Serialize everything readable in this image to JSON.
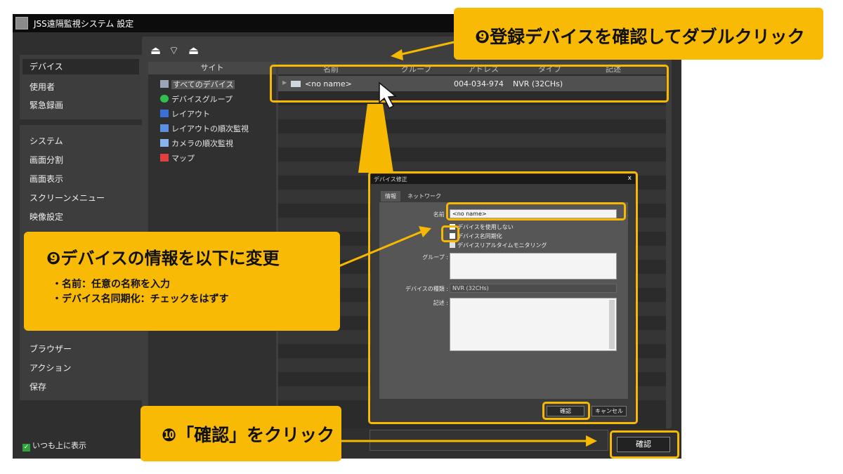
{
  "window": {
    "title": "JSS遠隔監視システム 設定"
  },
  "sidebar": {
    "group1": [
      "デバイス",
      "使用者",
      "緊急録画"
    ],
    "group2": [
      "システム",
      "画面分割",
      "画面表示",
      "スクリーンメニュー",
      "映像設定",
      "ブラウザー",
      "アクション",
      "保存"
    ],
    "always_on_top": "いつも上に表示"
  },
  "site_panel": {
    "header": "サイト",
    "items": [
      "すべてのデバイス",
      "デバイスグループ",
      "レイアウト",
      "レイアウトの順次監視",
      "カメラの順次監視",
      "マップ"
    ]
  },
  "device_list": {
    "columns": [
      "名前",
      "グループ",
      "アドレス",
      "タイプ",
      "記述"
    ],
    "rows": [
      {
        "name": "<no name>",
        "group": "",
        "address": "004-034-974",
        "type": "NVR (32CHs)",
        "description": ""
      }
    ]
  },
  "dialog": {
    "title": "デバイス修正",
    "close": "x",
    "tabs": [
      "情報",
      "ネットワーク"
    ],
    "name_label": "名前 :",
    "name_value": "<no name>",
    "checkboxes": [
      "デバイスを使用しない",
      "デバイス名同期化",
      "デバイスリアルタイムモニタリング"
    ],
    "group_label": "グループ :",
    "type_label": "デバイスの種類 :",
    "type_value": "NVR (32CHs)",
    "desc_label": "記述 :",
    "ok": "確認",
    "cancel": "キャンセル"
  },
  "main_confirm": "確認",
  "annotations": {
    "step9a": "❾登録デバイスを確認してダブルクリック",
    "step9b_title": "❾デバイスの情報を以下に変更",
    "step9b_line1": "・名前：任意の名称を入力",
    "step9b_line2": "・デバイス名同期化：チェックをはずす",
    "step10": "❿「確認」をクリック"
  },
  "colors": {
    "accent": "#f6b800",
    "callout": "#f8ba05"
  }
}
